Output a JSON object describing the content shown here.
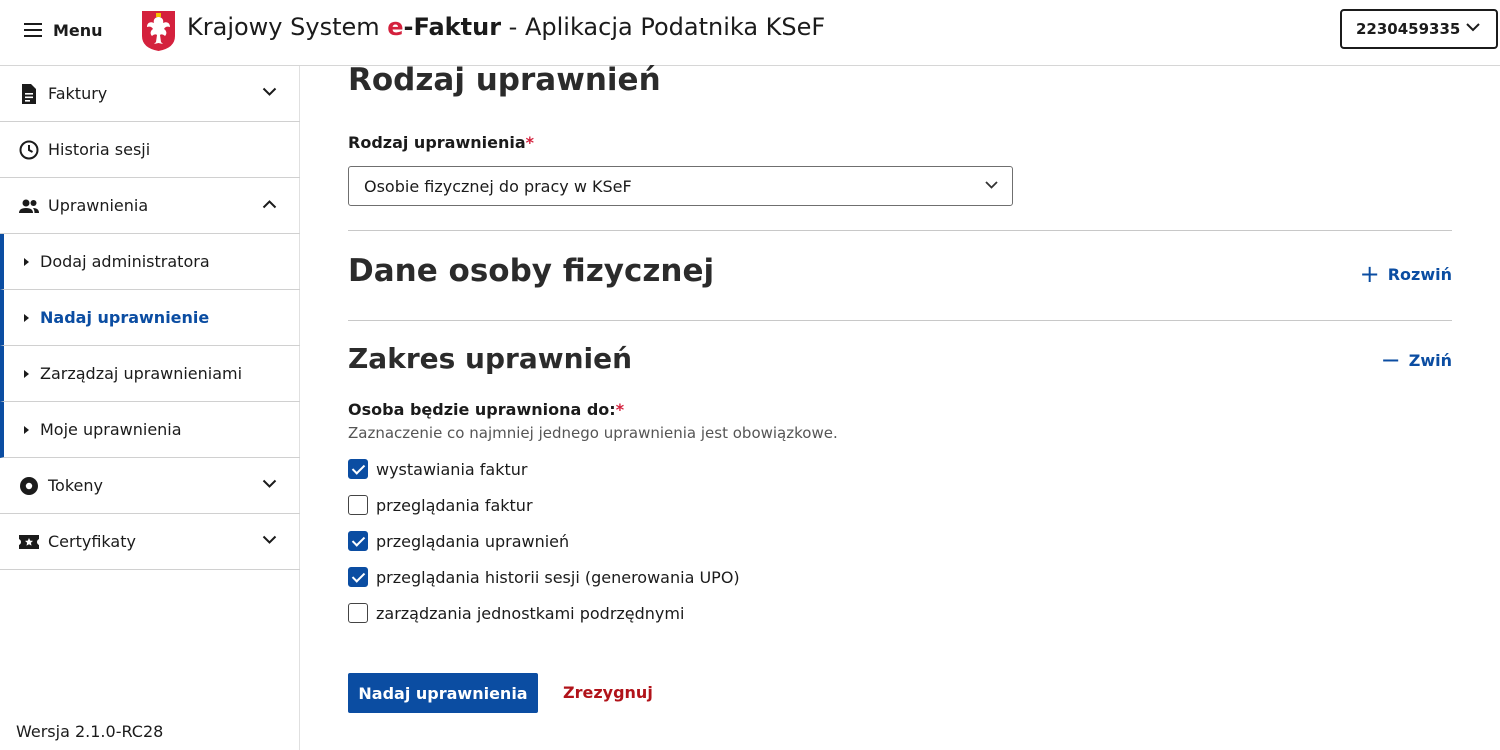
{
  "header": {
    "menu_label": "Menu",
    "title_prefix": "Krajowy System ",
    "title_e": "e",
    "title_dash": "-",
    "title_faktur": "Faktur",
    "title_suffix": " - Aplikacja Podatnika KSeF",
    "nip_value": "2230459335"
  },
  "sidebar": {
    "items": [
      {
        "label": "Faktury",
        "icon": "document-icon"
      },
      {
        "label": "Historia sesji",
        "icon": "clock-icon"
      },
      {
        "label": "Uprawnienia",
        "icon": "people-icon"
      }
    ],
    "sub_items": [
      {
        "label": "Dodaj administratora"
      },
      {
        "label": "Nadaj uprawnienie"
      },
      {
        "label": "Zarządzaj uprawnieniami"
      },
      {
        "label": "Moje uprawnienia"
      }
    ],
    "items_after": [
      {
        "label": "Tokeny",
        "icon": "disc-icon"
      },
      {
        "label": "Certyfikaty",
        "icon": "certificate-icon"
      }
    ],
    "version": "Wersja 2.1.0-RC28"
  },
  "main": {
    "section1_title": "Rodzaj uprawnień",
    "type_label": "Rodzaj uprawnienia",
    "required_mark": "*",
    "type_value": "Osobie fizycznej do pracy w KSeF",
    "section2_title": "Dane osoby fizycznej",
    "expand_label": "Rozwiń",
    "section3_title": "Zakres uprawnień",
    "collapse_label": "Zwiń",
    "scope_label": "Osoba będzie uprawniona do:",
    "scope_hint": "Zaznaczenie co najmniej jednego uprawnienia jest obowiązkowe.",
    "permissions": [
      {
        "label": "wystawiania faktur",
        "checked": true
      },
      {
        "label": "przeglądania faktur",
        "checked": false
      },
      {
        "label": "przeglądania uprawnień",
        "checked": true
      },
      {
        "label": "przeglądania historii sesji (generowania UPO)",
        "checked": true
      },
      {
        "label": "zarządzania jednostkami podrzędnymi",
        "checked": false
      }
    ],
    "submit_label": "Nadaj uprawnienia",
    "cancel_label": "Zrezygnuj"
  },
  "colors": {
    "accent": "#0b4da2",
    "required": "#d4213d",
    "cancel": "#b1131a"
  }
}
